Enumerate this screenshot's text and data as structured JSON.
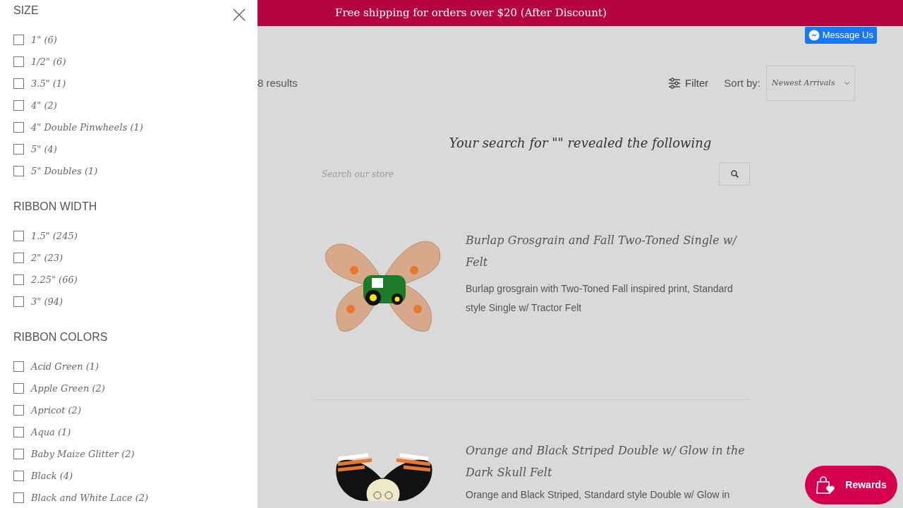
{
  "filter_panel": {
    "sections": [
      {
        "title": "SIZE",
        "options": [
          {
            "label": "1\" (6)",
            "checked": false
          },
          {
            "label": "1/2\" (6)",
            "checked": false
          },
          {
            "label": "3.5\" (1)",
            "checked": false
          },
          {
            "label": "4\" (2)",
            "checked": false
          },
          {
            "label": "4\" Double Pinwheels (1)",
            "checked": false
          },
          {
            "label": "5\" (4)",
            "checked": false
          },
          {
            "label": "5\" Doubles (1)",
            "checked": false
          }
        ]
      },
      {
        "title": "RIBBON WIDTH",
        "options": [
          {
            "label": "1.5\" (245)",
            "checked": false
          },
          {
            "label": "2\" (23)",
            "checked": false
          },
          {
            "label": "2.25\" (66)",
            "checked": false
          },
          {
            "label": "3\" (94)",
            "checked": false
          }
        ]
      },
      {
        "title": "RIBBON COLORS",
        "options": [
          {
            "label": "Acid Green (1)",
            "checked": false
          },
          {
            "label": "Apple Green (2)",
            "checked": false
          },
          {
            "label": "Apricot (2)",
            "checked": false
          },
          {
            "label": "Aqua (1)",
            "checked": false
          },
          {
            "label": "Baby Maize Glitter (2)",
            "checked": false
          },
          {
            "label": "Black (4)",
            "checked": false
          },
          {
            "label": "Black and White Lace (2)",
            "checked": false
          }
        ]
      }
    ]
  },
  "announcement": "Free shipping for orders over $20 (After Discount)",
  "message_button": "Message Us",
  "results_count": "8 results",
  "filter_button": "Filter",
  "sort": {
    "label": "Sort by:",
    "value": "Newest Arrivals"
  },
  "search_heading": "Your search for \"\" revealed the following",
  "search": {
    "placeholder": "Search our store"
  },
  "products": [
    {
      "kind": "tractor",
      "title": "Burlap Grosgrain and Fall Two-Toned Single w/ Felt",
      "description": "Burlap grosgrain with Two-Toned Fall inspired print, Standard style Single w/ Tractor Felt"
    },
    {
      "kind": "skull",
      "title": "Orange and Black Striped Double w/ Glow in the Dark Skull Felt",
      "description": "Orange and Black Striped, Standard style Double w/ Glow in"
    }
  ],
  "rewards_button": "Rewards"
}
